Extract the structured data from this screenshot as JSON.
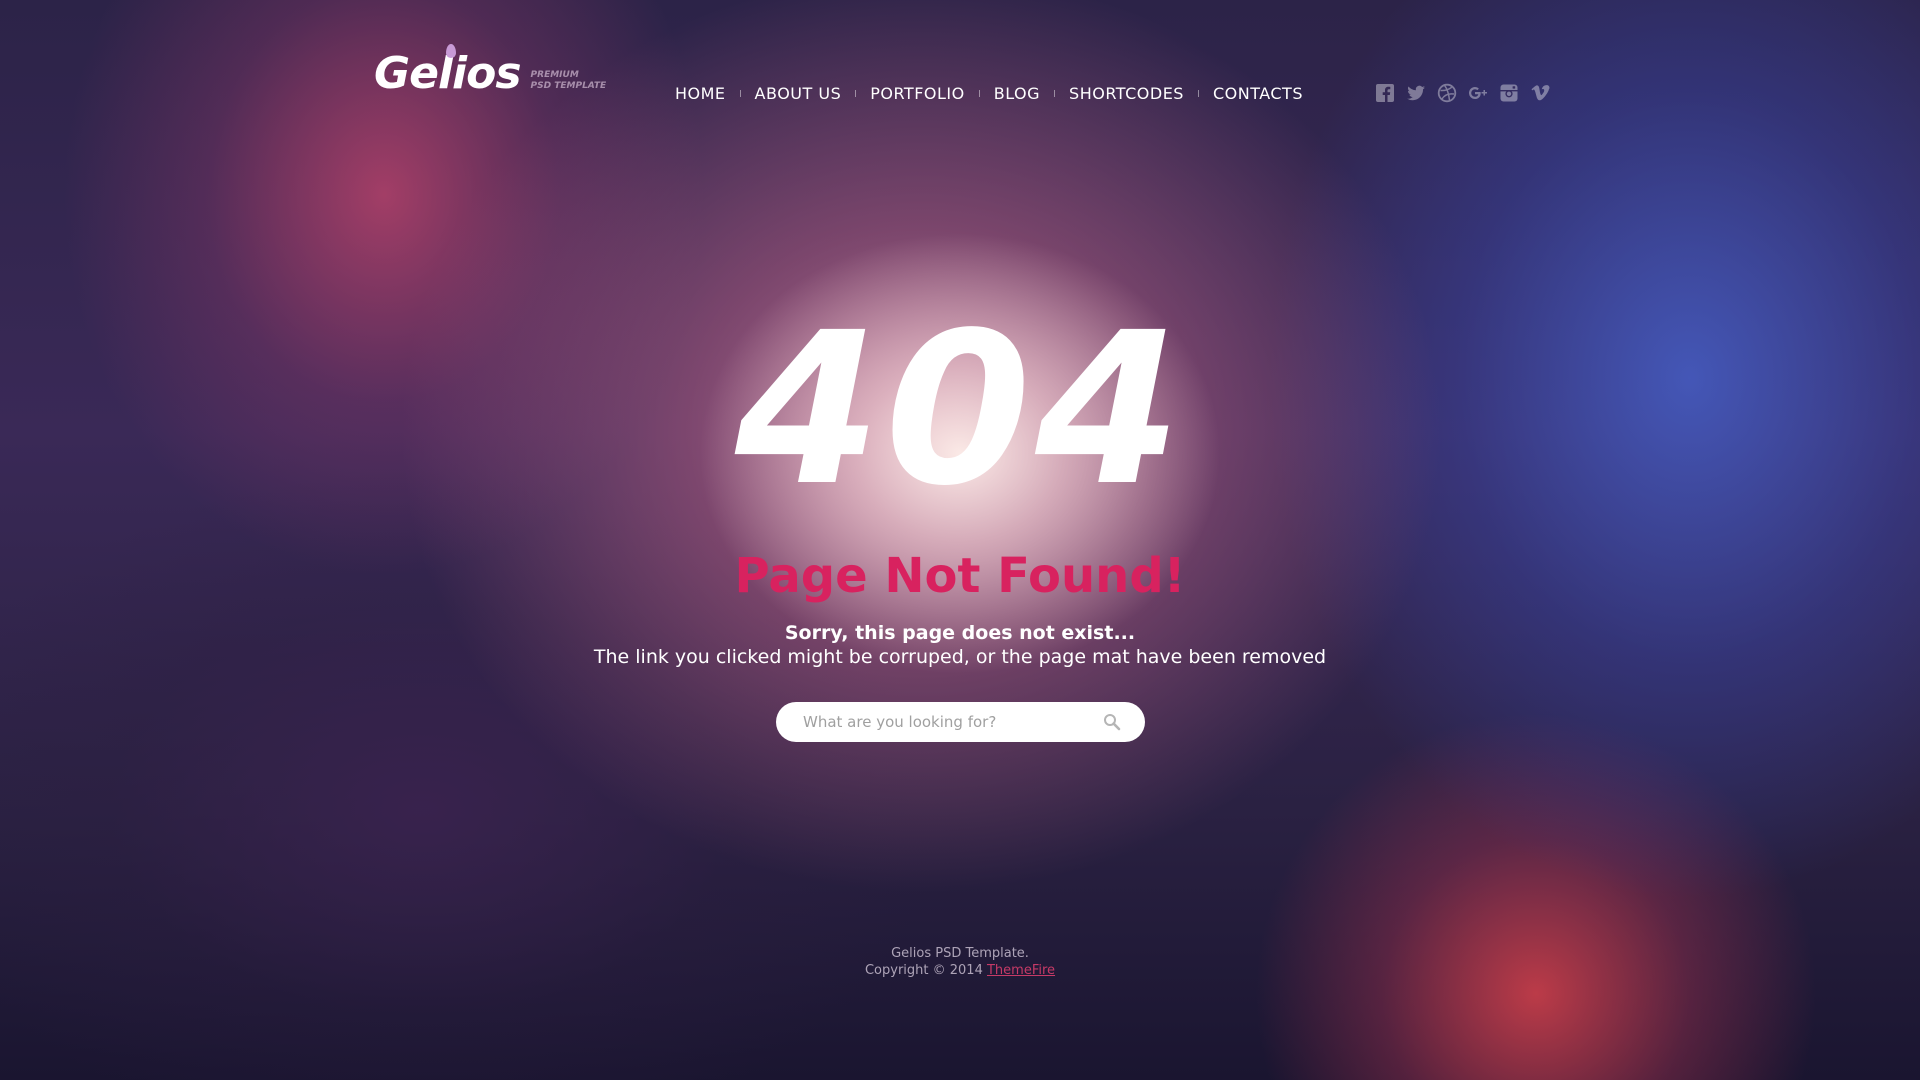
{
  "header": {
    "logo_text": "Gelios",
    "logo_tagline_1": "PREMIUM",
    "logo_tagline_2": "PSD TEMPLATE",
    "nav": [
      {
        "label": "HOME"
      },
      {
        "label": "ABOUT US"
      },
      {
        "label": "PORTFOLIO"
      },
      {
        "label": "BLOG"
      },
      {
        "label": "SHORTCODES"
      },
      {
        "label": "CONTACTS"
      }
    ],
    "social_icons": [
      "facebook-icon",
      "twitter-icon",
      "dribbble-icon",
      "google-plus-icon",
      "instagram-icon",
      "vimeo-icon"
    ]
  },
  "main": {
    "error_code": "404",
    "title": "Page Not Found!",
    "subtitle": "Sorry, this page does not exist...",
    "message": "The link you clicked might be corruped, or the page mat have been removed",
    "search": {
      "placeholder": "What are you looking for?"
    }
  },
  "footer": {
    "line1": "Gelios PSD Template.",
    "copyright": "Copyright © 2014",
    "link": "ThemeFire"
  },
  "colors": {
    "accent": "#d8225f",
    "text": "#ffffff",
    "footer_link": "#c63a67"
  }
}
